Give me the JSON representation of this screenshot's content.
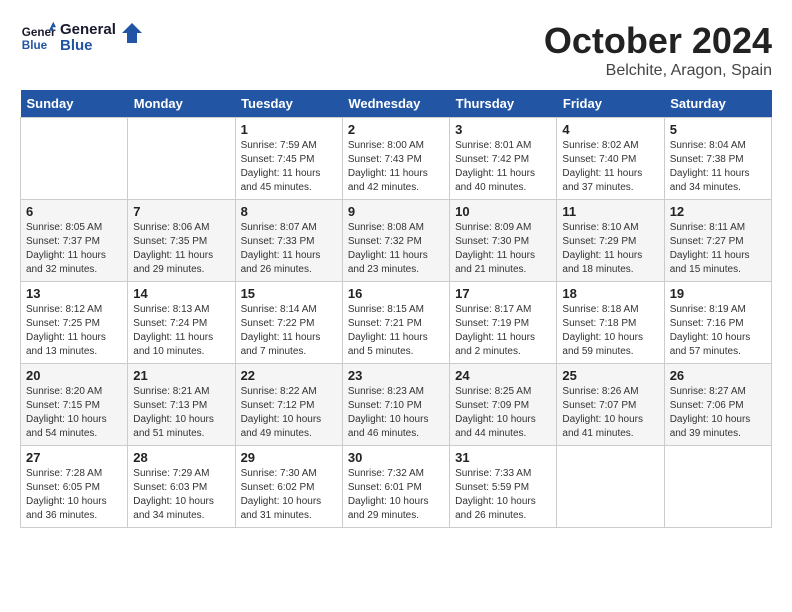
{
  "header": {
    "logo_line1": "General",
    "logo_line2": "Blue",
    "month": "October 2024",
    "location": "Belchite, Aragon, Spain"
  },
  "weekdays": [
    "Sunday",
    "Monday",
    "Tuesday",
    "Wednesday",
    "Thursday",
    "Friday",
    "Saturday"
  ],
  "weeks": [
    [
      {
        "day": "",
        "info": ""
      },
      {
        "day": "",
        "info": ""
      },
      {
        "day": "1",
        "info": "Sunrise: 7:59 AM\nSunset: 7:45 PM\nDaylight: 11 hours\nand 45 minutes."
      },
      {
        "day": "2",
        "info": "Sunrise: 8:00 AM\nSunset: 7:43 PM\nDaylight: 11 hours\nand 42 minutes."
      },
      {
        "day": "3",
        "info": "Sunrise: 8:01 AM\nSunset: 7:42 PM\nDaylight: 11 hours\nand 40 minutes."
      },
      {
        "day": "4",
        "info": "Sunrise: 8:02 AM\nSunset: 7:40 PM\nDaylight: 11 hours\nand 37 minutes."
      },
      {
        "day": "5",
        "info": "Sunrise: 8:04 AM\nSunset: 7:38 PM\nDaylight: 11 hours\nand 34 minutes."
      }
    ],
    [
      {
        "day": "6",
        "info": "Sunrise: 8:05 AM\nSunset: 7:37 PM\nDaylight: 11 hours\nand 32 minutes."
      },
      {
        "day": "7",
        "info": "Sunrise: 8:06 AM\nSunset: 7:35 PM\nDaylight: 11 hours\nand 29 minutes."
      },
      {
        "day": "8",
        "info": "Sunrise: 8:07 AM\nSunset: 7:33 PM\nDaylight: 11 hours\nand 26 minutes."
      },
      {
        "day": "9",
        "info": "Sunrise: 8:08 AM\nSunset: 7:32 PM\nDaylight: 11 hours\nand 23 minutes."
      },
      {
        "day": "10",
        "info": "Sunrise: 8:09 AM\nSunset: 7:30 PM\nDaylight: 11 hours\nand 21 minutes."
      },
      {
        "day": "11",
        "info": "Sunrise: 8:10 AM\nSunset: 7:29 PM\nDaylight: 11 hours\nand 18 minutes."
      },
      {
        "day": "12",
        "info": "Sunrise: 8:11 AM\nSunset: 7:27 PM\nDaylight: 11 hours\nand 15 minutes."
      }
    ],
    [
      {
        "day": "13",
        "info": "Sunrise: 8:12 AM\nSunset: 7:25 PM\nDaylight: 11 hours\nand 13 minutes."
      },
      {
        "day": "14",
        "info": "Sunrise: 8:13 AM\nSunset: 7:24 PM\nDaylight: 11 hours\nand 10 minutes."
      },
      {
        "day": "15",
        "info": "Sunrise: 8:14 AM\nSunset: 7:22 PM\nDaylight: 11 hours\nand 7 minutes."
      },
      {
        "day": "16",
        "info": "Sunrise: 8:15 AM\nSunset: 7:21 PM\nDaylight: 11 hours\nand 5 minutes."
      },
      {
        "day": "17",
        "info": "Sunrise: 8:17 AM\nSunset: 7:19 PM\nDaylight: 11 hours\nand 2 minutes."
      },
      {
        "day": "18",
        "info": "Sunrise: 8:18 AM\nSunset: 7:18 PM\nDaylight: 10 hours\nand 59 minutes."
      },
      {
        "day": "19",
        "info": "Sunrise: 8:19 AM\nSunset: 7:16 PM\nDaylight: 10 hours\nand 57 minutes."
      }
    ],
    [
      {
        "day": "20",
        "info": "Sunrise: 8:20 AM\nSunset: 7:15 PM\nDaylight: 10 hours\nand 54 minutes."
      },
      {
        "day": "21",
        "info": "Sunrise: 8:21 AM\nSunset: 7:13 PM\nDaylight: 10 hours\nand 51 minutes."
      },
      {
        "day": "22",
        "info": "Sunrise: 8:22 AM\nSunset: 7:12 PM\nDaylight: 10 hours\nand 49 minutes."
      },
      {
        "day": "23",
        "info": "Sunrise: 8:23 AM\nSunset: 7:10 PM\nDaylight: 10 hours\nand 46 minutes."
      },
      {
        "day": "24",
        "info": "Sunrise: 8:25 AM\nSunset: 7:09 PM\nDaylight: 10 hours\nand 44 minutes."
      },
      {
        "day": "25",
        "info": "Sunrise: 8:26 AM\nSunset: 7:07 PM\nDaylight: 10 hours\nand 41 minutes."
      },
      {
        "day": "26",
        "info": "Sunrise: 8:27 AM\nSunset: 7:06 PM\nDaylight: 10 hours\nand 39 minutes."
      }
    ],
    [
      {
        "day": "27",
        "info": "Sunrise: 7:28 AM\nSunset: 6:05 PM\nDaylight: 10 hours\nand 36 minutes."
      },
      {
        "day": "28",
        "info": "Sunrise: 7:29 AM\nSunset: 6:03 PM\nDaylight: 10 hours\nand 34 minutes."
      },
      {
        "day": "29",
        "info": "Sunrise: 7:30 AM\nSunset: 6:02 PM\nDaylight: 10 hours\nand 31 minutes."
      },
      {
        "day": "30",
        "info": "Sunrise: 7:32 AM\nSunset: 6:01 PM\nDaylight: 10 hours\nand 29 minutes."
      },
      {
        "day": "31",
        "info": "Sunrise: 7:33 AM\nSunset: 5:59 PM\nDaylight: 10 hours\nand 26 minutes."
      },
      {
        "day": "",
        "info": ""
      },
      {
        "day": "",
        "info": ""
      }
    ]
  ]
}
